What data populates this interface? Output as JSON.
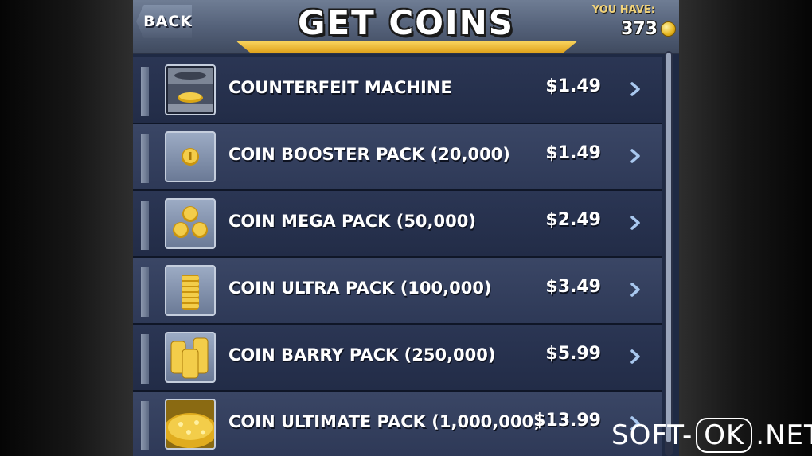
{
  "header": {
    "back_label": "BACK",
    "title": "GET COINS",
    "balance_label": "YOU HAVE:",
    "balance_value": "373"
  },
  "items": [
    {
      "label": "COUNTERFEIT MACHINE",
      "price": "$1.49",
      "icon": "counterfeit-machine-icon"
    },
    {
      "label": "COIN BOOSTER PACK (20,000)",
      "price": "$1.49",
      "icon": "single-coin-icon"
    },
    {
      "label": "COIN MEGA PACK (50,000)",
      "price": "$2.49",
      "icon": "three-coins-icon"
    },
    {
      "label": "COIN ULTRA PACK (100,000)",
      "price": "$3.49",
      "icon": "coin-stack-icon"
    },
    {
      "label": "COIN BARRY PACK (250,000)",
      "price": "$5.99",
      "icon": "coin-stacks-icon"
    },
    {
      "label": "COIN ULTIMATE PACK (1,000,000)",
      "price": "$13.99",
      "icon": "coin-pile-icon"
    }
  ],
  "watermark": {
    "left": "SOFT-",
    "boxed": "OK",
    "right": ".NET"
  },
  "colors": {
    "accent_gold": "#f0c23a",
    "row_dark": "#222c47",
    "row_light": "#2e3957"
  }
}
